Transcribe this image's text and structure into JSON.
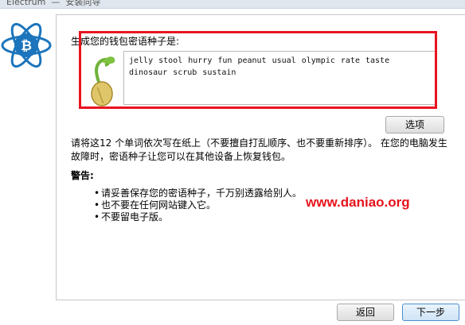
{
  "window": {
    "app_title": "Electrum",
    "dialog_title": "安装向导"
  },
  "seed_page": {
    "heading": "生成您的钱包密语种子是:",
    "seed_words": "jelly stool hurry fun peanut usual olympic rate taste dinosaur scrub sustain",
    "options_button": "选项",
    "instruction": "请将这12 个单词依次写在纸上（不要擅自打乱顺序、也不要重新排序）。 在您的电脑发生故障时，密语种子让您可以在其他设备上恢复钱包。",
    "warning_title": "警告:",
    "warnings": [
      "请妥善保存您的密语种子，千万别透露给别人。",
      "也不要在任何网站键入它。",
      "不要留电子版。"
    ]
  },
  "watermark": "www.daniao.org",
  "footer": {
    "back_button": "返回",
    "next_button": "下一步"
  },
  "colors": {
    "highlight": "#e8141f",
    "logo": "#1c75bc"
  },
  "icons": [
    "electrum-logo-icon",
    "seed-sprout-icon"
  ]
}
